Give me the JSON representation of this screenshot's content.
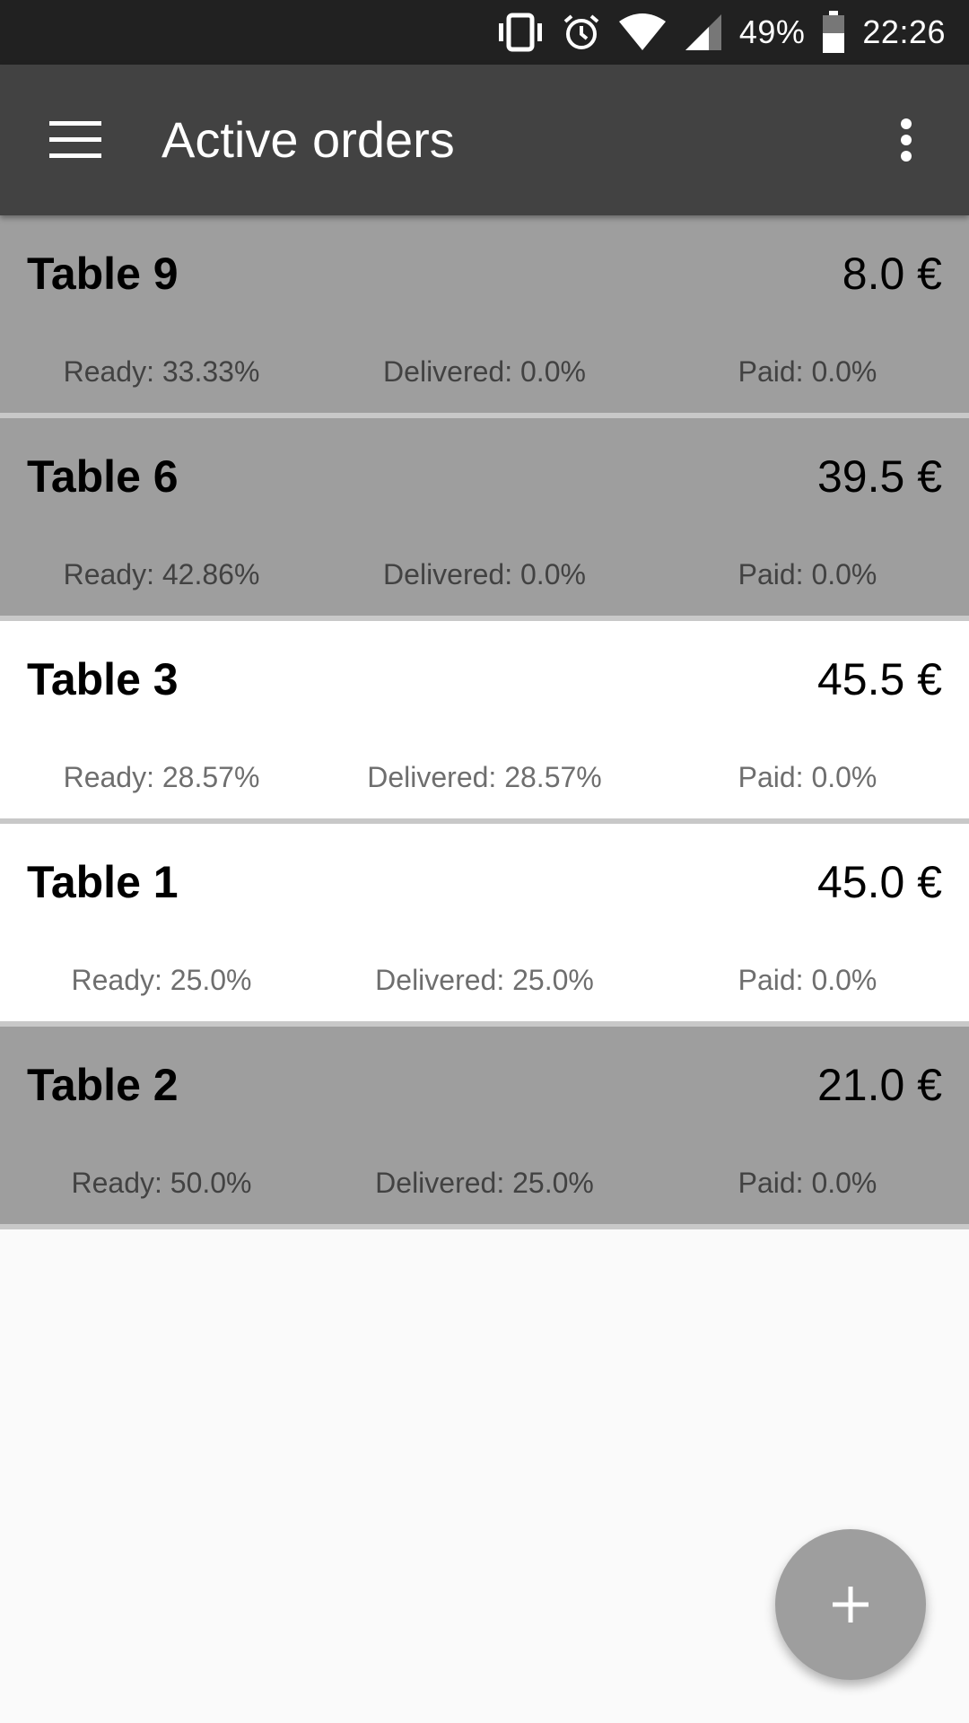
{
  "status_bar": {
    "icons": [
      "vibrate-icon",
      "alarm-icon",
      "wifi-icon",
      "cell-signal-icon",
      "battery-icon"
    ],
    "battery": "49%",
    "time": "22:26"
  },
  "app_bar": {
    "title": "Active orders",
    "menu_icon": "hamburger-menu-icon",
    "overflow_icon": "more-vert-icon"
  },
  "orders": [
    {
      "name": "Table 9",
      "total": "8.0 €",
      "ready": "Ready: 33.33%",
      "delivered": "Delivered: 0.0%",
      "paid": "Paid: 0.0%",
      "style": "dim"
    },
    {
      "name": "Table 6",
      "total": "39.5 €",
      "ready": "Ready: 42.86%",
      "delivered": "Delivered: 0.0%",
      "paid": "Paid: 0.0%",
      "style": "dim"
    },
    {
      "name": "Table 3",
      "total": "45.5 €",
      "ready": "Ready: 28.57%",
      "delivered": "Delivered: 28.57%",
      "paid": "Paid: 0.0%",
      "style": "light"
    },
    {
      "name": "Table 1",
      "total": "45.0 €",
      "ready": "Ready: 25.0%",
      "delivered": "Delivered: 25.0%",
      "paid": "Paid: 0.0%",
      "style": "light"
    },
    {
      "name": "Table 2",
      "total": "21.0 €",
      "ready": "Ready: 50.0%",
      "delivered": "Delivered: 25.0%",
      "paid": "Paid: 0.0%",
      "style": "dim"
    }
  ],
  "fab": {
    "icon": "plus-icon"
  },
  "colors": {
    "status_bar": "#212121",
    "app_bar": "#424242",
    "card_dim": "#9e9e9e",
    "card_light": "#ffffff",
    "fab": "#9e9e9e",
    "background": "#fafafa"
  }
}
